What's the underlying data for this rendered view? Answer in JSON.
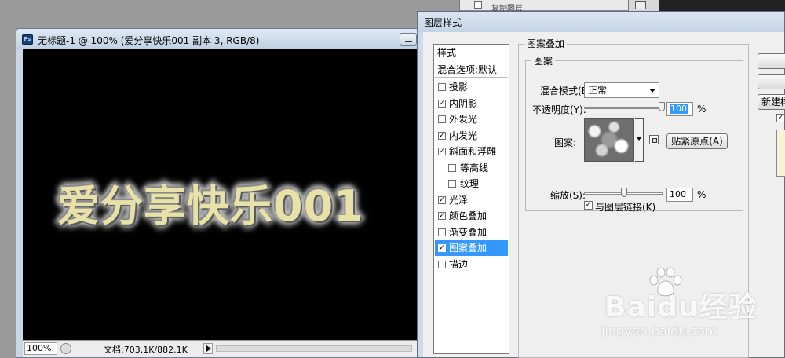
{
  "document": {
    "title": "无标题-1 @ 100% (爱分享快乐001 副本 3, RGB/8)",
    "canvas_text": "爱分享快乐001",
    "status": {
      "zoom": "100%",
      "doc_info": "文档:703.1K/882.1K"
    }
  },
  "dialog": {
    "title": "图层样式",
    "styles_header": "样式",
    "blend_options": "混合选项:默认",
    "style_items": [
      {
        "label": "投影",
        "checked": false,
        "sub": false
      },
      {
        "label": "内阴影",
        "checked": true,
        "sub": false
      },
      {
        "label": "外发光",
        "checked": false,
        "sub": false
      },
      {
        "label": "内发光",
        "checked": true,
        "sub": false
      },
      {
        "label": "斜面和浮雕",
        "checked": true,
        "sub": false
      },
      {
        "label": "等高线",
        "checked": false,
        "sub": true
      },
      {
        "label": "纹理",
        "checked": false,
        "sub": true
      },
      {
        "label": "光泽",
        "checked": true,
        "sub": false
      },
      {
        "label": "颜色叠加",
        "checked": true,
        "sub": false
      },
      {
        "label": "渐变叠加",
        "checked": false,
        "sub": false
      },
      {
        "label": "图案叠加",
        "checked": true,
        "sub": false,
        "selected": true
      },
      {
        "label": "描边",
        "checked": false,
        "sub": false
      }
    ],
    "panel": {
      "group_title": "图案叠加",
      "subgroup_title": "图案",
      "blend_mode_label": "混合模式(B):",
      "blend_mode_value": "正常",
      "opacity_label": "不透明度(Y):",
      "opacity_value": "100",
      "opacity_unit": "%",
      "pattern_label": "图案:",
      "snap_origin_button": "贴紧原点(A)",
      "scale_label": "缩放(S):",
      "scale_value": "100",
      "scale_unit": "%",
      "link_with_layer_label": "与图层链接(K)",
      "link_with_layer_checked": true
    },
    "right_buttons": {
      "ok": "",
      "cancel": "",
      "new_style": "新建样式..."
    },
    "preview_checked": true
  },
  "watermark": {
    "logo_text": "Baidu经验",
    "url": "jingyan.baidu.com"
  },
  "background": {
    "layers_row_text": "复制图层"
  }
}
